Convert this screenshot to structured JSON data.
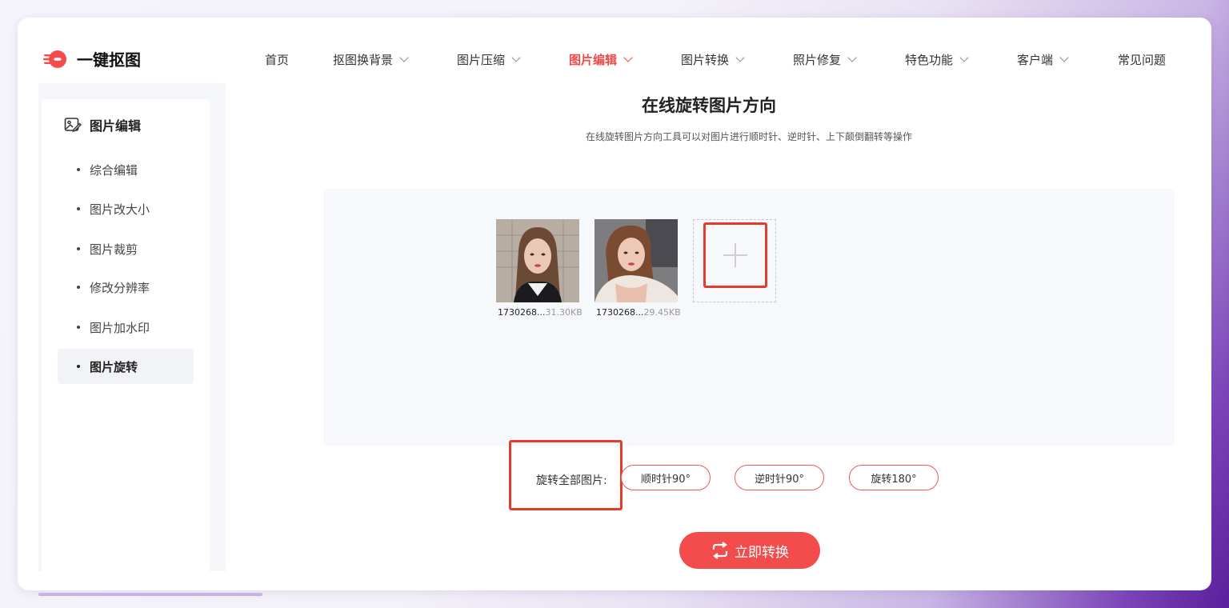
{
  "brand": {
    "name": "一键抠图",
    "accent": "#f14848"
  },
  "nav": {
    "items": [
      {
        "label": "首页",
        "dropdown": false,
        "active": false
      },
      {
        "label": "抠图换背景",
        "dropdown": true,
        "active": false
      },
      {
        "label": "图片压缩",
        "dropdown": true,
        "active": false
      },
      {
        "label": "图片编辑",
        "dropdown": true,
        "active": true
      },
      {
        "label": "图片转换",
        "dropdown": true,
        "active": false
      },
      {
        "label": "照片修复",
        "dropdown": true,
        "active": false
      },
      {
        "label": "特色功能",
        "dropdown": true,
        "active": false
      },
      {
        "label": "客户端",
        "dropdown": true,
        "active": false
      },
      {
        "label": "常见问题",
        "dropdown": false,
        "active": false
      }
    ]
  },
  "sidebar": {
    "title": "图片编辑",
    "items": [
      {
        "label": "综合编辑",
        "active": false
      },
      {
        "label": "图片改大小",
        "active": false
      },
      {
        "label": "图片裁剪",
        "active": false
      },
      {
        "label": "修改分辨率",
        "active": false
      },
      {
        "label": "图片加水印",
        "active": false
      },
      {
        "label": "图片旋转",
        "active": true
      }
    ]
  },
  "main": {
    "title": "在线旋转图片方向",
    "subtitle": "在线旋转图片方向工具可以对图片进行顺时针、逆时针、上下颠倒翻转等操作",
    "files": [
      {
        "name": "1730268...",
        "size": "31.30KB",
        "icon": "photo-thumbnail"
      },
      {
        "name": "1730268...",
        "size": "29.45KB",
        "icon": "photo-thumbnail"
      }
    ],
    "add_icon": "plus-icon",
    "rotate_all_label": "旋转全部图片:",
    "rotate_buttons": [
      "顺时针90°",
      "逆时针90°",
      "旋转180°"
    ],
    "convert_button": "立即转换",
    "convert_icon": "repeat-icon"
  }
}
